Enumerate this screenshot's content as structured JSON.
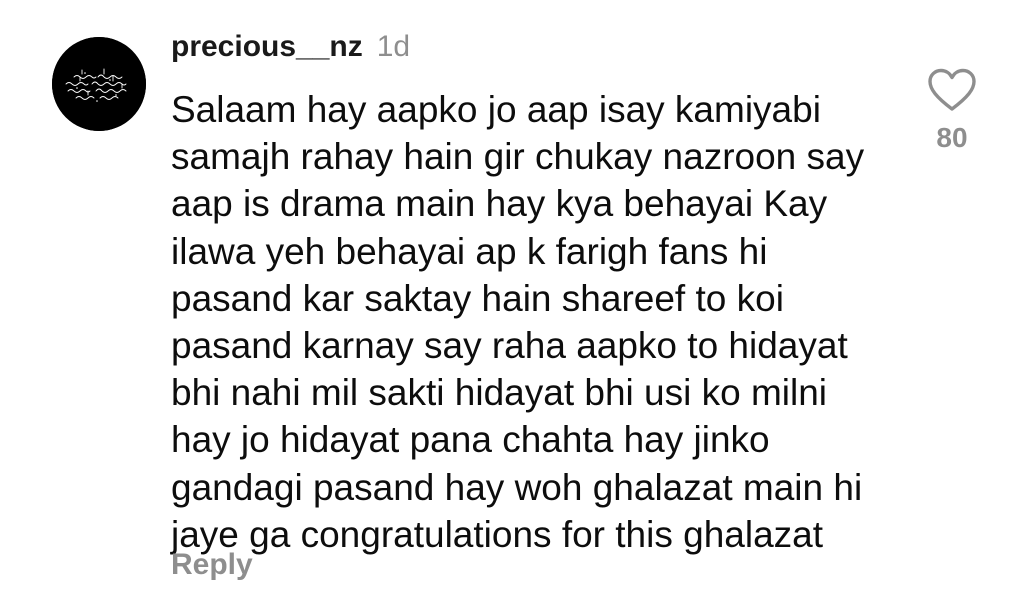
{
  "comment": {
    "username": "precious__nz",
    "time": "1d",
    "lines": [
      "Salaam hay aapko jo aap isay kamiyabi",
      "samajh rahay hain gir chukay nazroon say",
      "aap is drama main hay kya behayai Kay",
      "ilawa yeh behayai ap k farigh fans hi",
      "pasand kar saktay hain shareef to koi",
      "pasand karnay say raha aapko to hidayat",
      "bhi nahi mil sakti hidayat bhi usi ko milni",
      "hay jo hidayat pana chahta hay jinko",
      "gandagi pasand hay woh ghalazat main hi",
      "jaye ga congratulations for this ghalazat"
    ],
    "reply_label": "Reply",
    "like_count": "80",
    "like_icon": "heart-outline-icon",
    "avatar": "black circular avatar with white Arabic calligraphy"
  },
  "colors": {
    "text": "#0d0d0d",
    "secondary": "#8e8e8e",
    "background": "#ffffff",
    "avatar_bg": "#000000"
  }
}
